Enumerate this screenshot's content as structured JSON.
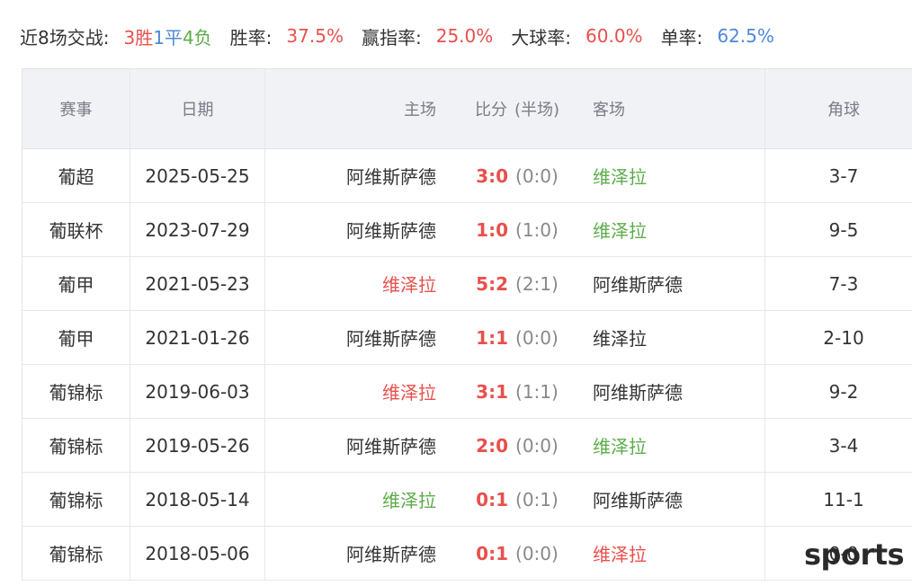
{
  "summary": {
    "label": "近8场交战:",
    "wins": "3胜",
    "draws": "1平",
    "losses": "4负",
    "win_rate_label": "胜率:",
    "win_rate": "37.5%",
    "handicap_rate_label": "赢指率:",
    "handicap_rate": "25.0%",
    "over_rate_label": "大球率:",
    "over_rate": "60.0%",
    "odd_rate_label": "单率:",
    "odd_rate": "62.5%"
  },
  "headers": {
    "competition": "赛事",
    "date": "日期",
    "home": "主场",
    "score": "比分",
    "half": "(半场)",
    "away": "客场",
    "corners": "角球"
  },
  "rows": [
    {
      "competition": "葡超",
      "date": "2025-05-25",
      "home": "阿维斯萨德",
      "score": "3:0",
      "half": "(0:0)",
      "away": "维泽拉",
      "corners": "3-7"
    },
    {
      "competition": "葡联杯",
      "date": "2023-07-29",
      "home": "阿维斯萨德",
      "score": "1:0",
      "half": "(1:0)",
      "away": "维泽拉",
      "corners": "9-5"
    },
    {
      "competition": "葡甲",
      "date": "2021-05-23",
      "home": "维泽拉",
      "score": "5:2",
      "half": "(2:1)",
      "away": "阿维斯萨德",
      "corners": "7-3"
    },
    {
      "competition": "葡甲",
      "date": "2021-01-26",
      "home": "阿维斯萨德",
      "score": "1:1",
      "half": "(0:0)",
      "away": "维泽拉",
      "corners": "2-10"
    },
    {
      "competition": "葡锦标",
      "date": "2019-06-03",
      "home": "维泽拉",
      "score": "3:1",
      "half": "(1:1)",
      "away": "阿维斯萨德",
      "corners": "9-2"
    },
    {
      "competition": "葡锦标",
      "date": "2019-05-26",
      "home": "阿维斯萨德",
      "score": "2:0",
      "half": "(0:0)",
      "away": "维泽拉",
      "corners": "3-4"
    },
    {
      "competition": "葡锦标",
      "date": "2018-05-14",
      "home": "维泽拉",
      "score": "0:1",
      "half": "(0:1)",
      "away": "阿维斯萨德",
      "corners": "11-1"
    },
    {
      "competition": "葡锦标",
      "date": "2018-05-06",
      "home": "阿维斯萨德",
      "score": "0:1",
      "half": "(0:0)",
      "away": "维泽拉",
      "corners": "0-0"
    }
  ],
  "watermark": "sports",
  "colors": {
    "red": "#e8504c",
    "green": "#5bad4a",
    "blue": "#4e88d9",
    "text": "#333333",
    "header_bg": "#f1f2f6"
  }
}
